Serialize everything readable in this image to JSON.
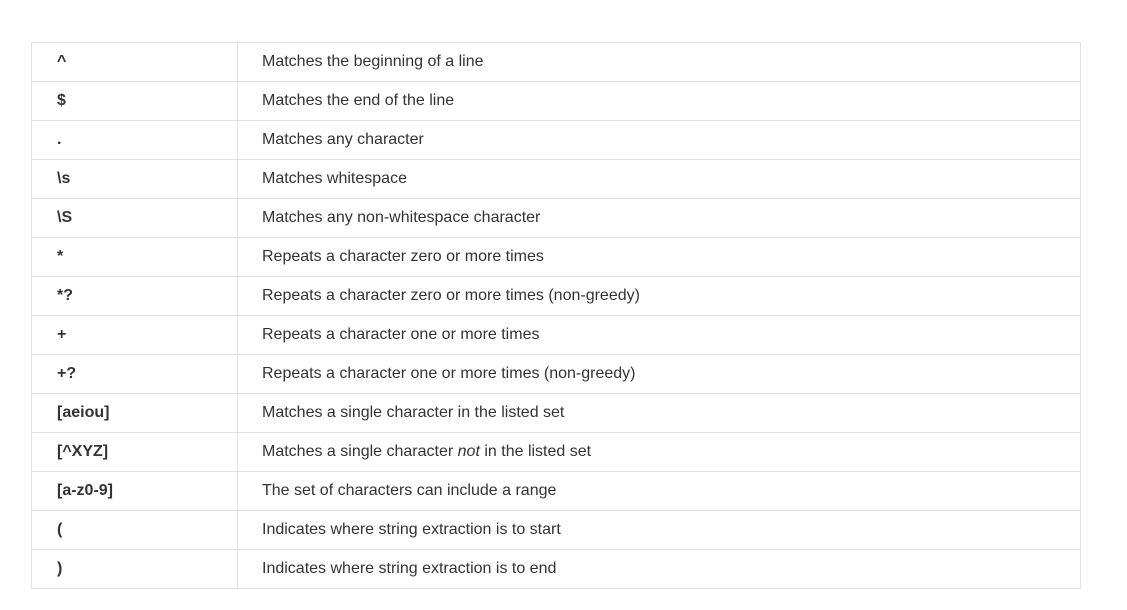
{
  "table": {
    "rows": [
      {
        "symbol": "^",
        "description": "Matches the beginning of a line"
      },
      {
        "symbol": "$",
        "description": "Matches the end of the line"
      },
      {
        "symbol": ".",
        "description": "Matches any character"
      },
      {
        "symbol": "\\s",
        "description": "Matches whitespace"
      },
      {
        "symbol": "\\S",
        "description": "Matches any non-whitespace character"
      },
      {
        "symbol": "*",
        "description": "Repeats a character zero or more times"
      },
      {
        "symbol": "*?",
        "description": "Repeats a character zero or more times (non-greedy)"
      },
      {
        "symbol": "+",
        "description": "Repeats a character one or more times"
      },
      {
        "symbol": "+?",
        "description": "Repeats a character one or more times (non-greedy)"
      },
      {
        "symbol": "[aeiou]",
        "description": "Matches a single character in the listed set"
      },
      {
        "symbol": "[^XYZ]",
        "description_before": "Matches a single character ",
        "description_emphasis": "not",
        "description_after": " in the listed set"
      },
      {
        "symbol": "[a-z0-9]",
        "description": "The set of characters can include a range"
      },
      {
        "symbol": "(",
        "description": "Indicates where string extraction is to start"
      },
      {
        "symbol": ")",
        "description": "Indicates where string extraction is to end"
      }
    ]
  }
}
